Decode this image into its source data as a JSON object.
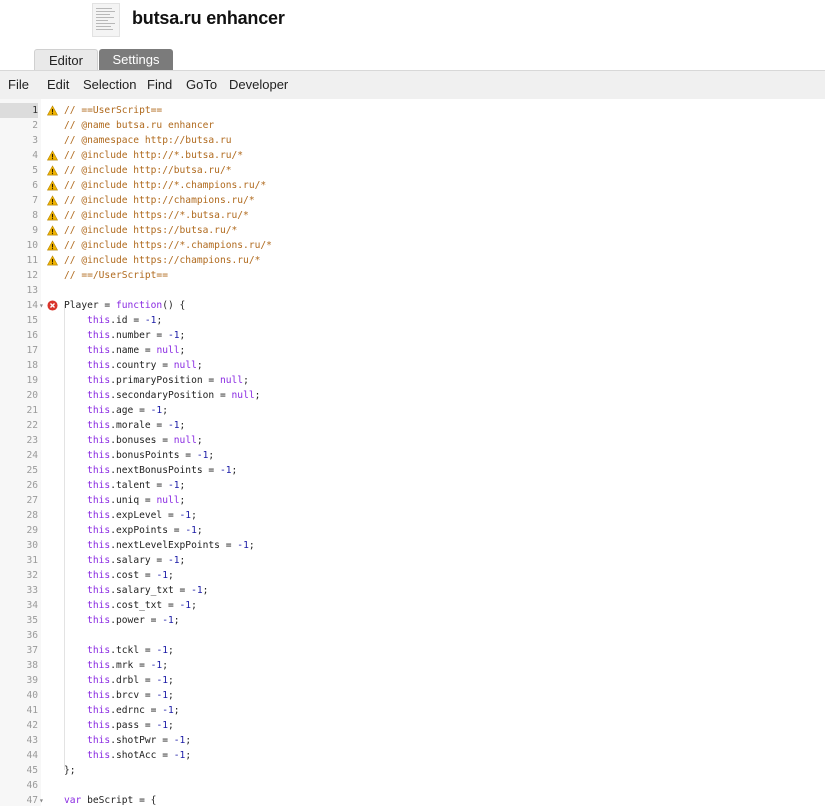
{
  "app": {
    "title": "butsa.ru enhancer"
  },
  "tabs": [
    {
      "label": "Editor"
    },
    {
      "label": "Settings"
    }
  ],
  "menu": [
    "File",
    "Edit",
    "Selection",
    "Find",
    "GoTo",
    "Developer"
  ],
  "colors": {
    "comment": "#b06a1e",
    "keyword": "#8a2be2",
    "literal": "#1a1aa6",
    "active_tab": "#7b7b7b",
    "warning": "#f0b400",
    "error": "#d9342b"
  },
  "editor": {
    "active_line": 1,
    "lines": [
      {
        "n": "1",
        "mark": "warning",
        "text": "// ==UserScript=="
      },
      {
        "n": "2",
        "mark": "",
        "text": "// @name butsa.ru enhancer"
      },
      {
        "n": "3",
        "mark": "",
        "text": "// @namespace http://butsa.ru"
      },
      {
        "n": "4",
        "mark": "warning",
        "text": "// @include http://*.butsa.ru/*"
      },
      {
        "n": "5",
        "mark": "warning",
        "text": "// @include http://butsa.ru/*"
      },
      {
        "n": "6",
        "mark": "warning",
        "text": "// @include http://*.champions.ru/*"
      },
      {
        "n": "7",
        "mark": "warning",
        "text": "// @include http://champions.ru/*"
      },
      {
        "n": "8",
        "mark": "warning",
        "text": "// @include https://*.butsa.ru/*"
      },
      {
        "n": "9",
        "mark": "warning",
        "text": "// @include https://butsa.ru/*"
      },
      {
        "n": "10",
        "mark": "warning",
        "text": "// @include https://*.champions.ru/*"
      },
      {
        "n": "11",
        "mark": "warning",
        "text": "// @include https://champions.ru/*"
      },
      {
        "n": "12",
        "mark": "",
        "text": "// ==/UserScript=="
      },
      {
        "n": "13",
        "mark": "",
        "text": ""
      },
      {
        "n": "14",
        "mark": "error",
        "fold": true,
        "text": "Player = function() {"
      },
      {
        "n": "15",
        "mark": "",
        "text": "    this.id = -1;"
      },
      {
        "n": "16",
        "mark": "",
        "text": "    this.number = -1;"
      },
      {
        "n": "17",
        "mark": "",
        "text": "    this.name = null;"
      },
      {
        "n": "18",
        "mark": "",
        "text": "    this.country = null;"
      },
      {
        "n": "19",
        "mark": "",
        "text": "    this.primaryPosition = null;"
      },
      {
        "n": "20",
        "mark": "",
        "text": "    this.secondaryPosition = null;"
      },
      {
        "n": "21",
        "mark": "",
        "text": "    this.age = -1;"
      },
      {
        "n": "22",
        "mark": "",
        "text": "    this.morale = -1;"
      },
      {
        "n": "23",
        "mark": "",
        "text": "    this.bonuses = null;"
      },
      {
        "n": "24",
        "mark": "",
        "text": "    this.bonusPoints = -1;"
      },
      {
        "n": "25",
        "mark": "",
        "text": "    this.nextBonusPoints = -1;"
      },
      {
        "n": "26",
        "mark": "",
        "text": "    this.talent = -1;"
      },
      {
        "n": "27",
        "mark": "",
        "text": "    this.uniq = null;"
      },
      {
        "n": "28",
        "mark": "",
        "text": "    this.expLevel = -1;"
      },
      {
        "n": "29",
        "mark": "",
        "text": "    this.expPoints = -1;"
      },
      {
        "n": "30",
        "mark": "",
        "text": "    this.nextLevelExpPoints = -1;"
      },
      {
        "n": "31",
        "mark": "",
        "text": "    this.salary = -1;"
      },
      {
        "n": "32",
        "mark": "",
        "text": "    this.cost = -1;"
      },
      {
        "n": "33",
        "mark": "",
        "text": "    this.salary_txt = -1;"
      },
      {
        "n": "34",
        "mark": "",
        "text": "    this.cost_txt = -1;"
      },
      {
        "n": "35",
        "mark": "",
        "text": "    this.power = -1;"
      },
      {
        "n": "36",
        "mark": "",
        "text": ""
      },
      {
        "n": "37",
        "mark": "",
        "text": "    this.tckl = -1;"
      },
      {
        "n": "38",
        "mark": "",
        "text": "    this.mrk = -1;"
      },
      {
        "n": "39",
        "mark": "",
        "text": "    this.drbl = -1;"
      },
      {
        "n": "40",
        "mark": "",
        "text": "    this.brcv = -1;"
      },
      {
        "n": "41",
        "mark": "",
        "text": "    this.edrnc = -1;"
      },
      {
        "n": "42",
        "mark": "",
        "text": "    this.pass = -1;"
      },
      {
        "n": "43",
        "mark": "",
        "text": "    this.shotPwr = -1;"
      },
      {
        "n": "44",
        "mark": "",
        "text": "    this.shotAcc = -1;"
      },
      {
        "n": "45",
        "mark": "",
        "text": "};"
      },
      {
        "n": "46",
        "mark": "",
        "text": ""
      },
      {
        "n": "47",
        "mark": "",
        "fold": true,
        "text": "var beScript = {"
      }
    ]
  }
}
